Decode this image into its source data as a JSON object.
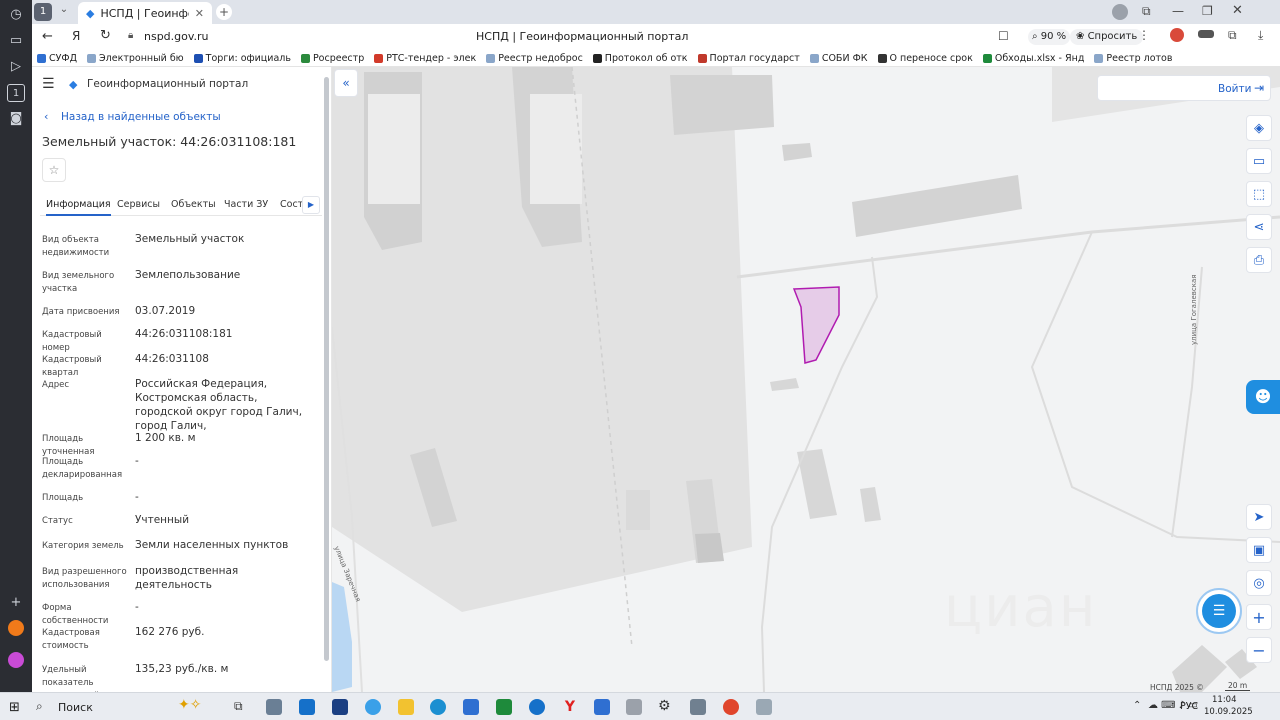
{
  "browser": {
    "tab_title": "НСПД | Геоинформационный портал",
    "tab_count": "1",
    "url": "nspd.gov.ru",
    "page_title": "НСПД | Геоинформационный портал",
    "zoom": "90 %",
    "ask_label": "Спросить"
  },
  "bookmarks": [
    {
      "label": "СУФД",
      "color": "#2f6fd1"
    },
    {
      "label": "Электронный бю",
      "color": "#8aa6c9"
    },
    {
      "label": "Торги: официаль",
      "color": "#1d4fb2"
    },
    {
      "label": "Росреестр",
      "color": "#2c8a3d"
    },
    {
      "label": "РТС-тендер - элек",
      "color": "#d23a2a"
    },
    {
      "label": "Реестр недоброс",
      "color": "#8aa6c9"
    },
    {
      "label": "Протокол об отк",
      "color": "#222222"
    },
    {
      "label": "Портал государст",
      "color": "#c0392b"
    },
    {
      "label": "СОБИ ФК",
      "color": "#8aa6c9"
    },
    {
      "label": "О переносе срок",
      "color": "#333333"
    },
    {
      "label": "Обходы.xlsx - Янд",
      "color": "#1e8a3b"
    },
    {
      "label": "Реестр лотов",
      "color": "#8aa6c9"
    }
  ],
  "panel": {
    "portal_title": "Геоинформационный портал",
    "back_link": "Назад в найденные объекты",
    "object_title": "Земельный участок: 44:26:031108:181",
    "tabs": [
      "Информация",
      "Сервисы",
      "Объекты",
      "Части ЗУ",
      "Соста"
    ],
    "rows": [
      {
        "label": "Вид объекта недвижимости",
        "value": "Земельный участок"
      },
      {
        "label": "Вид земельного участка",
        "value": "Землепользование"
      },
      {
        "label": "Дата присвоения",
        "value": "03.07.2019"
      },
      {
        "label": "Кадастровый номер",
        "value": "44:26:031108:181"
      },
      {
        "label": "Кадастровый квартал",
        "value": "44:26:031108"
      },
      {
        "label": "Адрес",
        "value": "Российская Федерация, Костромская область, городской округ город Галич, город Галич,"
      },
      {
        "label": "Площадь уточненная",
        "value": "1 200 кв. м"
      },
      {
        "label": "Площадь декларированная",
        "value": "-"
      },
      {
        "label": "Площадь",
        "value": "-"
      },
      {
        "label": "Статус",
        "value": "Учтенный"
      },
      {
        "label": "Категория земель",
        "value": "Земли населенных пунктов"
      },
      {
        "label": "Вид разрешенного использования",
        "value": "производственная деятельность"
      },
      {
        "label": "Форма собственности",
        "value": "-"
      },
      {
        "label": "Кадастровая стоимость",
        "value": "162 276 руб."
      },
      {
        "label": "Удельный показатель кадастровой",
        "value": "135,23 руб./кв. м"
      }
    ]
  },
  "map": {
    "login_label": "Войти",
    "street_1": "улица Гогалевская",
    "street_2": "улица Заречная",
    "copyright": "НСПД 2025 ©",
    "scale": "20 m",
    "watermark": "циан",
    "parcel_color": "#b01bb0"
  },
  "taskbar": {
    "search_label": "Поиск",
    "language": "РУС",
    "time": "11:04",
    "date": "10.09.2025"
  }
}
